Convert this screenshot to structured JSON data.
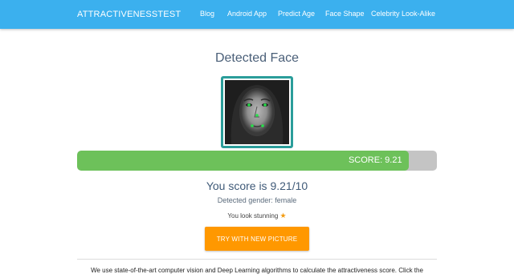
{
  "navbar": {
    "brand": "ATTRACTIVENESSTEST",
    "links": [
      "Blog",
      "Android App",
      "Predict Age",
      "Face Shape",
      "Celebrity Look-Alike"
    ],
    "background_color": "#3bb0ee"
  },
  "result": {
    "heading": "Detected Face",
    "face_image": "detected-face-photo-with-landmarks",
    "score_label": "SCORE: 9.21",
    "score_fraction": 0.921,
    "score_text": "You score is 9.21/10",
    "gender_text": "Detected gender: female",
    "verdict_text": "You look stunning",
    "verdict_icon": "star-icon",
    "progress_color": "#6dc15a",
    "frame_color": "#2a9d9a"
  },
  "actions": {
    "try_again_label": "TRY WITH NEW PICTURE",
    "button_color": "#ff9800"
  },
  "footer": {
    "description": "We use state-of-the-art computer vision and Deep Learning algorithms to calculate the attractiveness score. Click the"
  }
}
